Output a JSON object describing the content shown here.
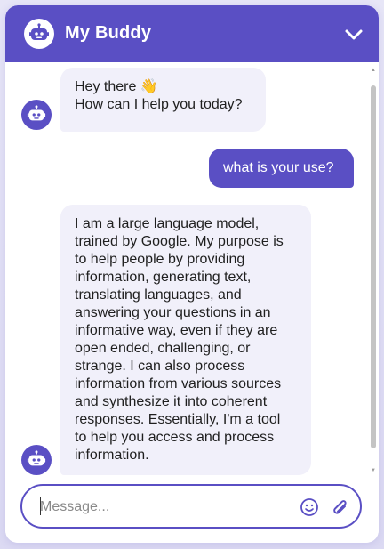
{
  "header": {
    "title": "My Buddy",
    "brand_color": "#5a4fc4",
    "avatar_icon": "robot-icon",
    "collapse_icon": "chevron-down-icon"
  },
  "messages": [
    {
      "sender": "bot",
      "lines": [
        "Hey there 👋",
        "How can I help you today?"
      ]
    },
    {
      "sender": "user",
      "text": "what is your use?"
    },
    {
      "sender": "bot",
      "lines": [
        "I am a large language model,",
        "trained by Google. My purpose is",
        "to help people by providing",
        "information, generating text,",
        "translating languages, and",
        "answering your questions in an",
        "informative way, even if they are",
        "open ended, challenging, or",
        "strange. I can also process",
        "information from various sources",
        "and synthesize it into coherent",
        "responses. Essentially, I'm a tool",
        "to help you access and process",
        "information."
      ]
    }
  ],
  "composer": {
    "placeholder": "Message...",
    "emoji_icon": "emoji-icon",
    "attach_icon": "paperclip-icon"
  }
}
